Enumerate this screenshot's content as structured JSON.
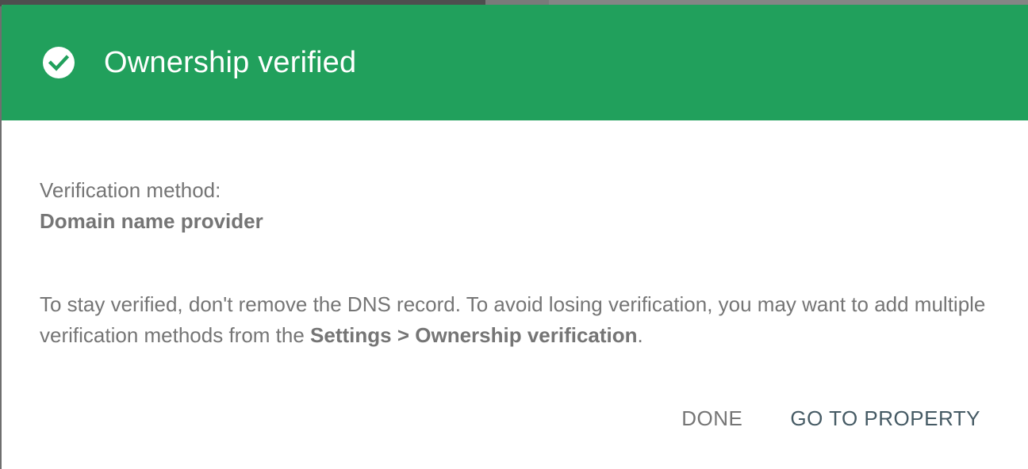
{
  "dialog": {
    "title": "Ownership verified",
    "header_color": "#21a05c",
    "header_icon": "check-circle-icon",
    "method_label": "Verification method:",
    "method_value": "Domain name provider",
    "info_text_before": "To stay verified, don't remove the DNS record. To avoid losing verification, you may want to add multiple verification methods from the ",
    "info_text_bold": "Settings > Ownership verification",
    "info_text_after": ".",
    "actions": {
      "done_label": "DONE",
      "go_label": "GO TO PROPERTY"
    }
  }
}
